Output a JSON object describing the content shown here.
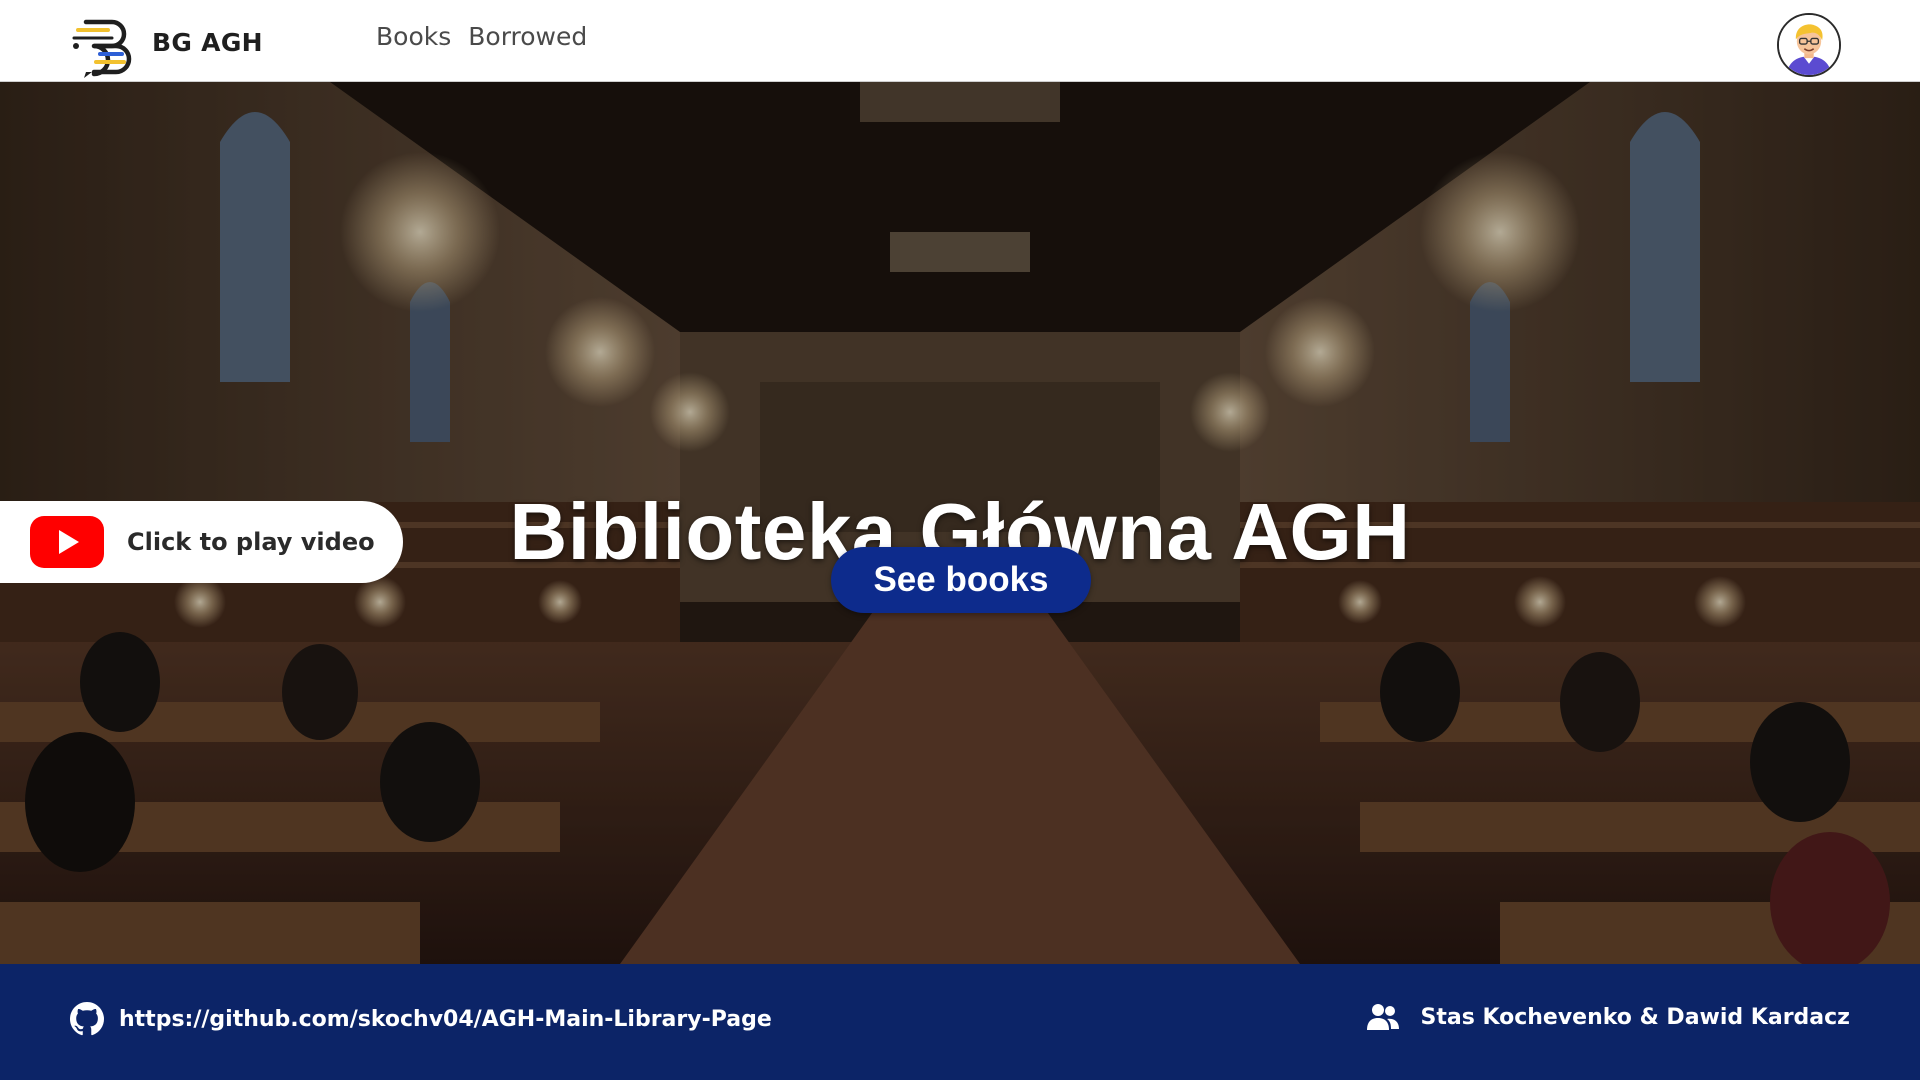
{
  "header": {
    "logo_text": "BG AGH",
    "logo_icon": "book-chat-logo-icon",
    "nav": [
      {
        "label": "Books"
      },
      {
        "label": "Borrowed"
      }
    ],
    "avatar_icon": "user-avatar-icon"
  },
  "hero": {
    "background": "library-reading-room-photo",
    "title": "Biblioteka Główna AGH",
    "cta_label": "See books",
    "video_label": "Click to play video",
    "video_icon": "youtube-play-icon"
  },
  "footer": {
    "repo_icon": "github-icon",
    "repo_url": "https://github.com/skochv04/AGH-Main-Library-Page",
    "authors_icon": "users-icon",
    "authors": "Stas Kochevenko & Dawid Kardacz"
  },
  "colors": {
    "brand_navy": "#0c2467",
    "cta_blue": "#0d2b8c",
    "youtube_red": "#ff0000",
    "logo_yellow": "#f2c12e",
    "logo_blue": "#2d5fd6"
  }
}
